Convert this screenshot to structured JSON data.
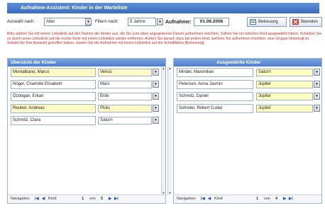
{
  "window": {
    "title": "Aufnahme-Assistent: Kinder in der Warteliste"
  },
  "toolbar": {
    "sort_label": "Auswahl nach:",
    "sort_value": "Alter",
    "filter_label": "Filtern nach:",
    "filter_value": "5 Jahr/e",
    "admission_label": "Aufnahme:",
    "admission_date": "01.08.2006",
    "care_button": "Betreuung",
    "end_button": "Beenden"
  },
  "hint": "Bitte wählen Sie mit einem Linksklick auf den Namen die Kinder aus, die Sie zum oben angegebenen Datum aufnehmen möchten. Sollten Sie ein falsches Kind ausgewählt haben, Schieben Sie es durch einen Linksklick auf die rechte Seite mit einem Linksklick wieder entfernen. Achten Sie darauf, dass bei jedem Kind, welches Sie aufnehmen möchten, eine Gruppe hinterlegt ist. Sobald Sie Ihre Auswahl getroffen haben, starten Sie die Aufnahme mit einem Linksklick auf die Schaltfläche [Betreuung].",
  "left_panel": {
    "title": "Übersicht der Kinder",
    "rows": [
      {
        "name": "Montalbano, Marco",
        "group": "Venus",
        "highlight": true
      },
      {
        "name": "Nögel, Charlotte Elisabeth",
        "group": "Mars",
        "highlight": false
      },
      {
        "name": "Özdogan, Erkan",
        "group": "Erde",
        "highlight": false
      },
      {
        "name": "Reuber, Andreas",
        "group": "Pluto",
        "highlight": true
      },
      {
        "name": "Schmitz, Clara",
        "group": "Saturn",
        "highlight": false
      }
    ],
    "nav_label": "Navigation:",
    "nav_kind": "Kind:",
    "nav_page": "1",
    "nav_of": "von",
    "nav_total": "5"
  },
  "right_panel": {
    "title": "Ausgewählte Kinder",
    "rows": [
      {
        "name": "Mindel, Maximilian",
        "group": "Saturn"
      },
      {
        "name": "Petersen, Anna Jasmin",
        "group": "Jupiter"
      },
      {
        "name": "Schmitz, Daniel",
        "group": "Jupiter"
      },
      {
        "name": "Schreier, Robert Cudat",
        "group": "Jupiter"
      }
    ],
    "nav_label": "Navigation:",
    "nav_kind": "Kind:",
    "nav_page": "1",
    "nav_of": "von",
    "nav_total": "4"
  },
  "colors": {
    "title_bar": "#3a6cc0",
    "hint_text": "#cc2b2b",
    "highlight_row": "#fff9c8",
    "selected_group": "#ffffc0"
  }
}
